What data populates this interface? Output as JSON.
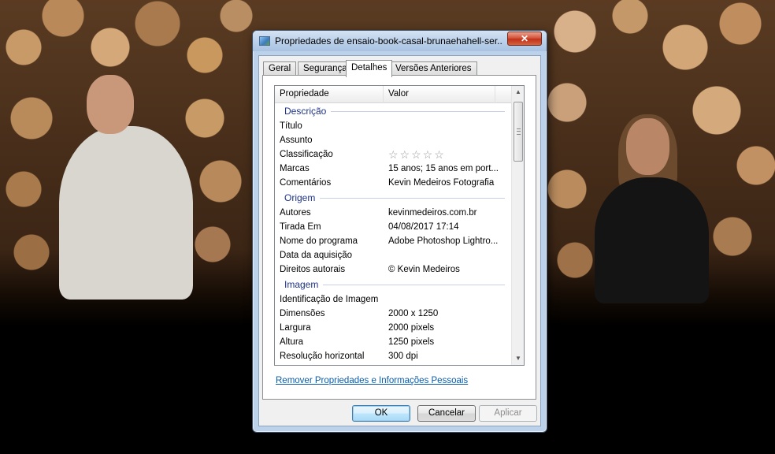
{
  "window": {
    "title": "Propriedades de ensaio-book-casal-brunaehahell-ser...",
    "close_label": "✕"
  },
  "tabs": [
    {
      "label": "Geral",
      "active": false
    },
    {
      "label": "Segurança",
      "active": false
    },
    {
      "label": "Detalhes",
      "active": true
    },
    {
      "label": "Versões Anteriores",
      "active": false
    }
  ],
  "list": {
    "columns": {
      "property": "Propriedade",
      "value": "Valor"
    },
    "sections": {
      "description": "Descrição",
      "origin": "Origem",
      "image": "Imagem"
    },
    "description_rows": [
      {
        "property": "Título",
        "value": ""
      },
      {
        "property": "Assunto",
        "value": ""
      },
      {
        "property": "Classificação",
        "value": "☆☆☆☆☆"
      },
      {
        "property": "Marcas",
        "value": "15 anos; 15 anos em port..."
      },
      {
        "property": "Comentários",
        "value": "Kevin Medeiros Fotografia"
      }
    ],
    "origin_rows": [
      {
        "property": "Autores",
        "value": "kevinmedeiros.com.br"
      },
      {
        "property": "Tirada Em",
        "value": "04/08/2017 17:14"
      },
      {
        "property": "Nome do programa",
        "value": "Adobe Photoshop Lightro..."
      },
      {
        "property": "Data da aquisição",
        "value": ""
      },
      {
        "property": "Direitos autorais",
        "value": "© Kevin Medeiros"
      }
    ],
    "image_rows": [
      {
        "property": "Identificação de Imagem",
        "value": ""
      },
      {
        "property": "Dimensões",
        "value": "2000 x 1250"
      },
      {
        "property": "Largura",
        "value": "2000 pixels"
      },
      {
        "property": "Altura",
        "value": "1250 pixels"
      },
      {
        "property": "Resolução horizontal",
        "value": "300 dpi"
      }
    ],
    "rating_stars": 0
  },
  "links": {
    "remove_properties": "Remover Propriedades e Informações Pessoais"
  },
  "buttons": {
    "ok": "OK",
    "cancel": "Cancelar",
    "apply": "Aplicar"
  },
  "icons": {
    "window_icon": "image-file-icon",
    "scroll_up": "▲",
    "scroll_down": "▼"
  }
}
